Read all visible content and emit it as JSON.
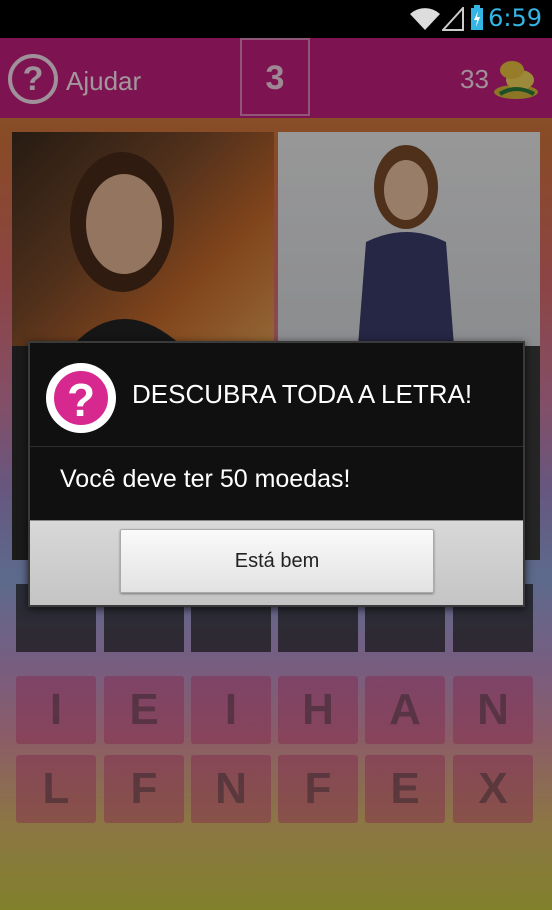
{
  "status_bar": {
    "time": "6:59",
    "wifi_icon": "wifi-icon",
    "signal_icon": "signal-icon",
    "battery_icon": "battery-charging-icon"
  },
  "header": {
    "help_label": "Ajudar",
    "help_icon": "question-mark-icon",
    "level": "3",
    "coins": "33",
    "coin_icon": "coins-icon"
  },
  "colors": {
    "header": "#c01e7c",
    "accent": "#d6288f",
    "clock": "#33b5e5"
  },
  "letters": {
    "row1": [
      "I",
      "E",
      "I",
      "H",
      "A",
      "N"
    ],
    "row2": [
      "L",
      "F",
      "N",
      "F",
      "E",
      "X"
    ]
  },
  "dialog": {
    "icon": "question-mark-icon",
    "title": "DESCUBRA TODA A LETRA!",
    "message": "Você deve ter 50 moedas!",
    "ok_label": "Está bem"
  }
}
